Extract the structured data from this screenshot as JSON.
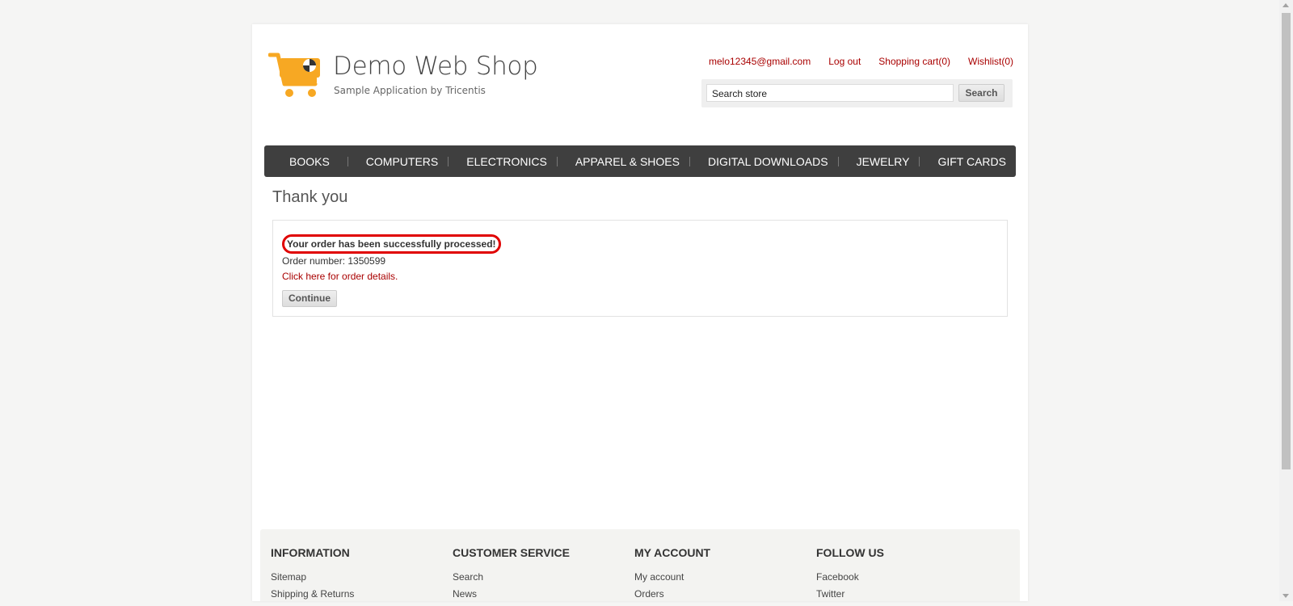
{
  "header": {
    "logo_title": "Demo Web Shop",
    "logo_subtitle": "Sample Application by Tricentis",
    "links": {
      "account_email": "melo12345@gmail.com",
      "logout": "Log out",
      "shopping_cart": "Shopping cart(0)",
      "wishlist": "Wishlist(0)"
    },
    "search": {
      "value": "Search store",
      "button_label": "Search"
    }
  },
  "nav": {
    "items": [
      "BOOKS",
      "COMPUTERS",
      "ELECTRONICS",
      "APPAREL & SHOES",
      "DIGITAL DOWNLOADS",
      "JEWELRY",
      "GIFT CARDS"
    ]
  },
  "main": {
    "title": "Thank you",
    "success_message": "Your order has been successfully processed!",
    "order_number": "Order number: 1350599",
    "order_details_link": "Click here for order details.",
    "continue_label": "Continue"
  },
  "footer": {
    "columns": [
      {
        "title": "INFORMATION",
        "links": [
          "Sitemap",
          "Shipping & Returns"
        ]
      },
      {
        "title": "CUSTOMER SERVICE",
        "links": [
          "Search",
          "News"
        ]
      },
      {
        "title": "MY ACCOUNT",
        "links": [
          "My account",
          "Orders"
        ]
      },
      {
        "title": "FOLLOW US",
        "links": [
          "Facebook",
          "Twitter"
        ]
      }
    ]
  },
  "colors": {
    "accent_link": "#a90000",
    "logo_orange": "#f7a823",
    "nav_background": "#3f3f3f",
    "highlight_ring": "#e00000"
  },
  "icons": {
    "logo": "shopping-cart-icon"
  }
}
